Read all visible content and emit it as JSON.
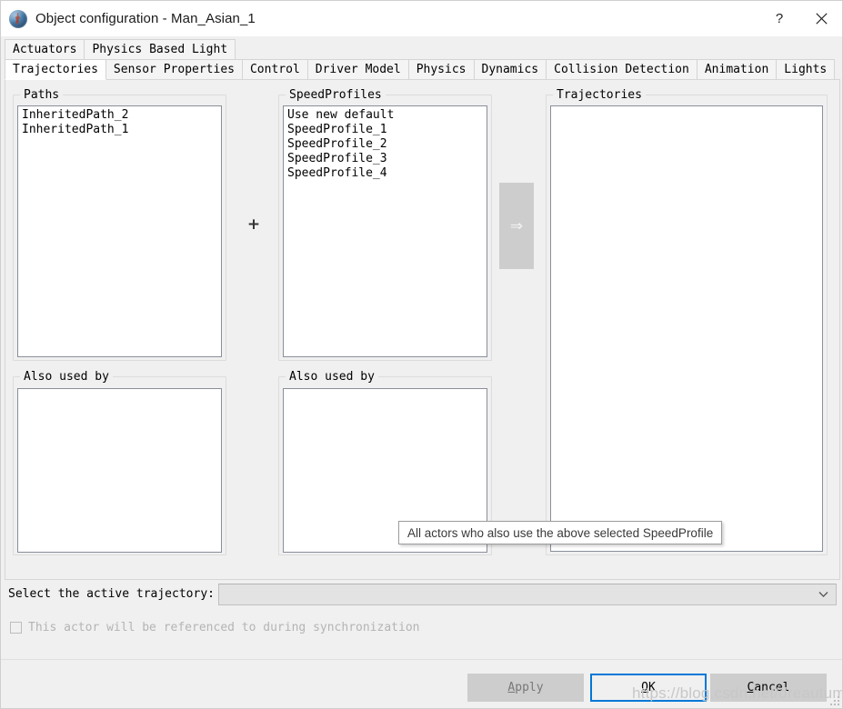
{
  "window": {
    "title": "Object configuration - Man_Asian_1",
    "icon": "app-globe-icon",
    "help_label": "?",
    "close_label": "✕"
  },
  "tabs": {
    "top_row": [
      {
        "label": "Actuators",
        "active": false
      },
      {
        "label": "Physics Based Light",
        "active": false
      }
    ],
    "bottom_row": [
      {
        "label": "Trajectories",
        "active": true
      },
      {
        "label": "Sensor Properties",
        "active": false
      },
      {
        "label": "Control",
        "active": false
      },
      {
        "label": "Driver Model",
        "active": false
      },
      {
        "label": "Physics",
        "active": false
      },
      {
        "label": "Dynamics",
        "active": false
      },
      {
        "label": "Collision Detection",
        "active": false
      },
      {
        "label": "Animation",
        "active": false
      },
      {
        "label": "Lights",
        "active": false
      }
    ]
  },
  "panels": {
    "paths": {
      "title": "Paths",
      "items": [
        "InheritedPath_2",
        "InheritedPath_1"
      ]
    },
    "paths_also_used_by": {
      "title": "Also used by",
      "items": []
    },
    "speed_profiles": {
      "title": "SpeedProfiles",
      "items": [
        "Use new default",
        "SpeedProfile_1",
        "SpeedProfile_2",
        "SpeedProfile_3",
        "SpeedProfile_4"
      ]
    },
    "speed_also_used_by": {
      "title": "Also used by",
      "items": []
    },
    "trajectories": {
      "title": "Trajectories",
      "items": []
    }
  },
  "combine": {
    "plus_glyph": "+",
    "transfer_glyph": "⇒"
  },
  "bottom": {
    "active_trajectory_label": "Select the active trajectory:",
    "active_trajectory_value": "",
    "chevron_glyph": "⌄",
    "sync_checkbox_label": "This actor will be referenced to during synchronization",
    "sync_checkbox_checked": false
  },
  "buttons": {
    "apply": {
      "label": "Apply",
      "mnemonic": "A",
      "enabled": false
    },
    "ok": {
      "label": "OK",
      "mnemonic": "O",
      "enabled": true,
      "focused": true
    },
    "cancel": {
      "label": "Cancel",
      "mnemonic": "C",
      "enabled": true
    }
  },
  "tooltip": {
    "text": "All actors who also use the above selected SpeedProfile"
  },
  "watermark": {
    "text": "https://blog.csdn.net/dreautumn"
  },
  "colors": {
    "dialog_bg": "#f0f0f0",
    "titlebar_bg": "#ffffff",
    "focus_blue": "#0078d7",
    "disabled_text": "#b4b4b4",
    "button_face": "#cdcdcd"
  }
}
